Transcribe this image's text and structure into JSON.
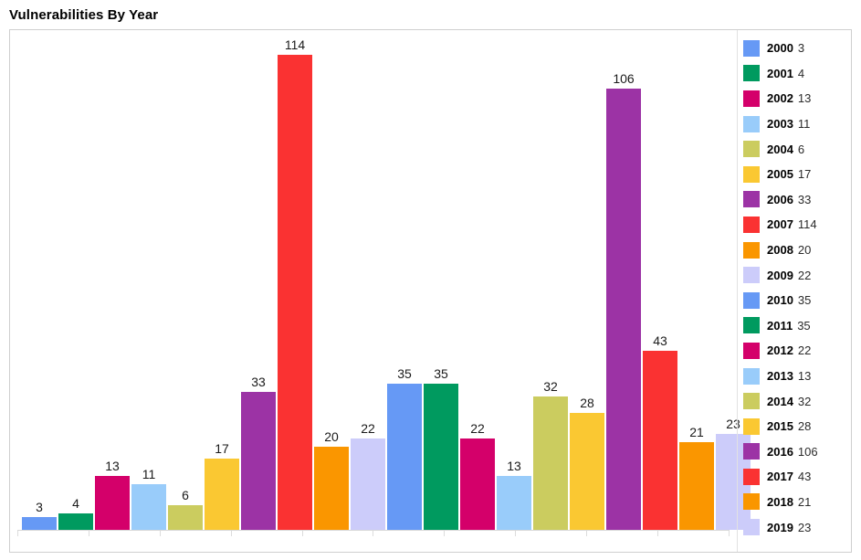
{
  "header": {
    "title": "Vulnerabilities By Year"
  },
  "legend": {
    "position": "right",
    "items": [
      {
        "year": "2000",
        "count": "3",
        "color": "#6699f5"
      },
      {
        "year": "2001",
        "count": "4",
        "color": "#009a5f"
      },
      {
        "year": "2002",
        "count": "13",
        "color": "#d4006a"
      },
      {
        "year": "2003",
        "count": "11",
        "color": "#99ccfa"
      },
      {
        "year": "2004",
        "count": "6",
        "color": "#cbcc5f"
      },
      {
        "year": "2005",
        "count": "17",
        "color": "#fac832"
      },
      {
        "year": "2006",
        "count": "33",
        "color": "#9c33a5"
      },
      {
        "year": "2007",
        "count": "114",
        "color": "#fa3232"
      },
      {
        "year": "2008",
        "count": "20",
        "color": "#fa9600"
      },
      {
        "year": "2009",
        "count": "22",
        "color": "#ccccfa"
      },
      {
        "year": "2010",
        "count": "35",
        "color": "#6699f5"
      },
      {
        "year": "2011",
        "count": "35",
        "color": "#009a5f"
      },
      {
        "year": "2012",
        "count": "22",
        "color": "#d4006a"
      },
      {
        "year": "2013",
        "count": "13",
        "color": "#99ccfa"
      },
      {
        "year": "2014",
        "count": "32",
        "color": "#cbcc5f"
      },
      {
        "year": "2015",
        "count": "28",
        "color": "#fac832"
      },
      {
        "year": "2016",
        "count": "106",
        "color": "#9c33a5"
      },
      {
        "year": "2017",
        "count": "43",
        "color": "#fa3232"
      },
      {
        "year": "2018",
        "count": "21",
        "color": "#fa9600"
      },
      {
        "year": "2019",
        "count": "23",
        "color": "#ccccfa"
      }
    ]
  },
  "chart_data": {
    "type": "bar",
    "title": "Vulnerabilities By Year",
    "xlabel": "",
    "ylabel": "",
    "ylim": [
      0,
      120
    ],
    "grid": false,
    "legend_position": "right",
    "data_labels": true,
    "categories": [
      "2000",
      "2001",
      "2002",
      "2003",
      "2004",
      "2005",
      "2006",
      "2007",
      "2008",
      "2009",
      "2010",
      "2011",
      "2012",
      "2013",
      "2014",
      "2015",
      "2016",
      "2017",
      "2018",
      "2019"
    ],
    "values": [
      3,
      4,
      13,
      11,
      6,
      17,
      33,
      114,
      20,
      22,
      35,
      35,
      22,
      13,
      32,
      28,
      106,
      43,
      21,
      23
    ],
    "colors": [
      "#6699f5",
      "#009a5f",
      "#d4006a",
      "#99ccfa",
      "#cbcc5f",
      "#fac832",
      "#9c33a5",
      "#fa3232",
      "#fa9600",
      "#ccccfa",
      "#6699f5",
      "#009a5f",
      "#d4006a",
      "#99ccfa",
      "#cbcc5f",
      "#fac832",
      "#9c33a5",
      "#fa3232",
      "#fa9600",
      "#ccccfa"
    ]
  },
  "style": {
    "frame_border": "#cfcfcf",
    "axis_color": "#d8d8d8",
    "background": "#ffffff"
  }
}
